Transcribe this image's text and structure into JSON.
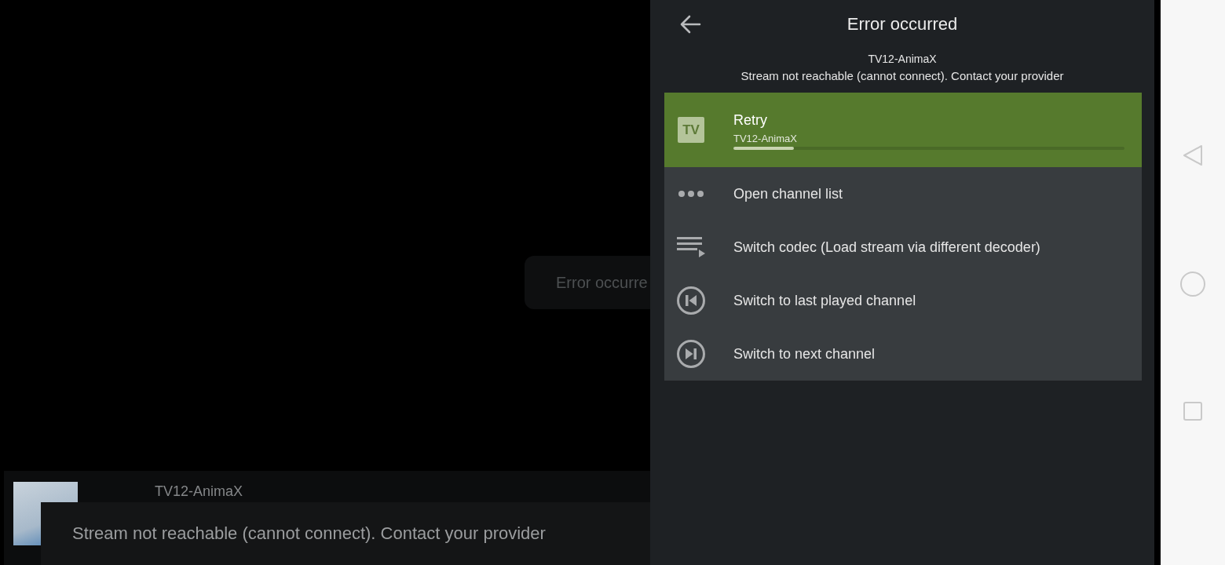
{
  "toast": {
    "text": "Error occurre"
  },
  "player_bar": {
    "channel": "TV12-AnimaX"
  },
  "snackbar": {
    "message": "Stream not reachable (cannot connect). Contact your provider"
  },
  "dialog": {
    "title": "Error occurred",
    "channel": "TV12-AnimaX",
    "message": "Stream not reachable (cannot connect). Contact your provider",
    "items": [
      {
        "label": "Retry",
        "logo": "TV",
        "subtitle": "TV12-AnimaX",
        "level": 0.155,
        "selected": true
      },
      {
        "label": "Open channel list",
        "selected": false
      },
      {
        "label": "Switch codec (Load stream via different decoder)",
        "selected": false
      },
      {
        "label": "Switch to last played channel",
        "selected": false
      },
      {
        "label": "Switch to next channel",
        "selected": false
      }
    ]
  }
}
